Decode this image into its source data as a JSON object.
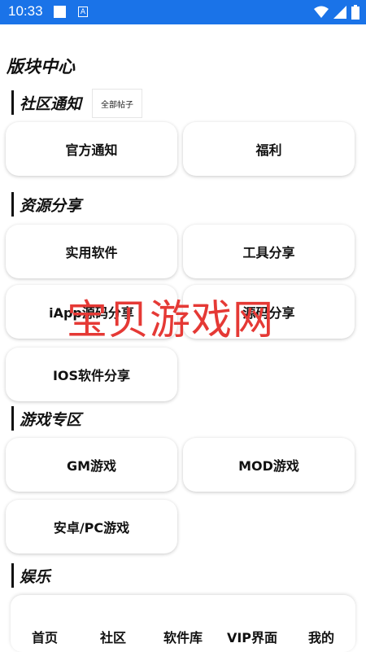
{
  "status_bar": {
    "time": "10:33",
    "badge": "A"
  },
  "page_title": "版块中心",
  "sections": [
    {
      "title": "社区通知",
      "action": "全部帖子",
      "items": [
        "官方通知",
        "福利"
      ]
    },
    {
      "title": "资源分享",
      "items": [
        "实用软件",
        "工具分享",
        "iApp源码分享",
        "源码分享",
        "IOS软件分享"
      ]
    },
    {
      "title": "游戏专区",
      "items": [
        "GM游戏",
        "MOD游戏",
        "安卓/PC游戏"
      ]
    },
    {
      "title": "娱乐"
    }
  ],
  "watermark": "宝贝游戏网",
  "bottom_nav": [
    "首页",
    "社区",
    "软件库",
    "VIP界面",
    "我的"
  ],
  "colors": {
    "status_bar": "#1a73e8",
    "watermark": "#e53935"
  }
}
